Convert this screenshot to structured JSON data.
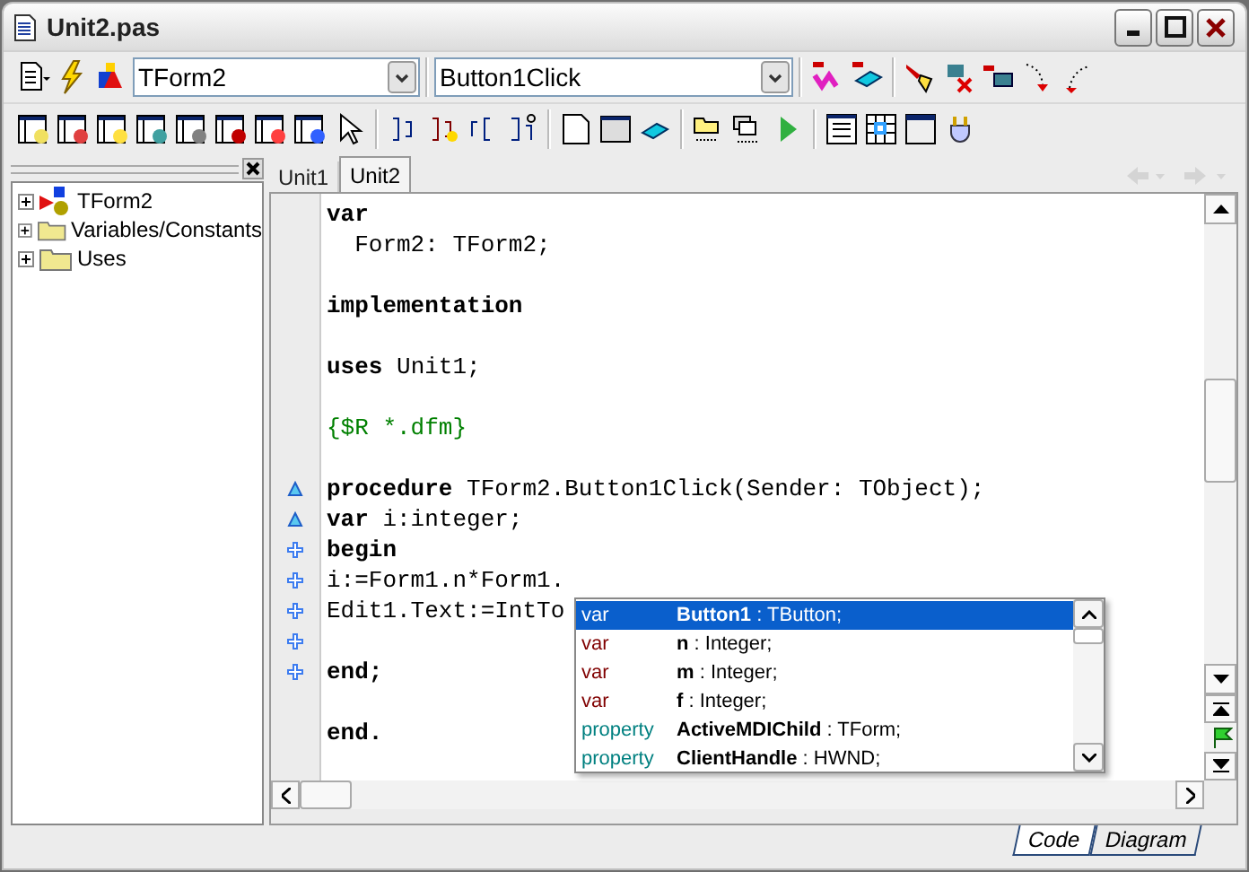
{
  "window": {
    "title": "Unit2.pas"
  },
  "toolbar": {
    "class_combo": {
      "value": "TForm2"
    },
    "method_combo": {
      "value": "Button1Click"
    }
  },
  "tree": [
    {
      "label": "TForm2",
      "kind": "class",
      "expanded": false
    },
    {
      "label": "Variables/Constants",
      "kind": "folder",
      "expanded": false
    },
    {
      "label": "Uses",
      "kind": "folder",
      "expanded": false
    }
  ],
  "editor_tabs": [
    {
      "label": "Unit1",
      "selected": false
    },
    {
      "label": "Unit2",
      "selected": true
    }
  ],
  "code_lines": [
    {
      "kind": "code",
      "text": "**var**"
    },
    {
      "kind": "code",
      "text": "  Form2: TForm2;"
    },
    {
      "kind": "blank"
    },
    {
      "kind": "code",
      "text": "**implementation**"
    },
    {
      "kind": "blank"
    },
    {
      "kind": "code",
      "text": "**uses** Unit1;"
    },
    {
      "kind": "blank"
    },
    {
      "kind": "comment",
      "text": "{$R *.dfm}"
    },
    {
      "kind": "blank"
    },
    {
      "kind": "code",
      "text": "**procedure** TForm2.Button1Click(Sender: TObject);",
      "marker": {
        "kind": "triangle"
      }
    },
    {
      "kind": "code",
      "text": "**var** i:integer;",
      "marker": {
        "kind": "triangle"
      }
    },
    {
      "kind": "code",
      "text": "**begin**",
      "marker": {
        "kind": "plus"
      }
    },
    {
      "kind": "code",
      "text": "i:=Form1.n*Form1.",
      "marker": {
        "kind": "plus"
      }
    },
    {
      "kind": "code",
      "text": "Edit1.Text:=IntTo",
      "marker": {
        "kind": "plus"
      }
    },
    {
      "kind": "blank",
      "marker": {
        "kind": "plus"
      }
    },
    {
      "kind": "code",
      "text": "**end;**",
      "marker": {
        "kind": "plus"
      }
    },
    {
      "kind": "blank"
    },
    {
      "kind": "code",
      "text": "**end.**"
    }
  ],
  "completion": [
    {
      "kind": "var",
      "scope": "var",
      "name": "Button1",
      "type": ": TButton;",
      "selected": true
    },
    {
      "kind": "var",
      "scope": "var",
      "name": "n",
      "type": ": Integer;",
      "selected": false
    },
    {
      "kind": "var",
      "scope": "var",
      "name": "m",
      "type": ": Integer;",
      "selected": false
    },
    {
      "kind": "var",
      "scope": "var",
      "name": "f",
      "type": ": Integer;",
      "selected": false
    },
    {
      "kind": "property",
      "scope": "property",
      "name": "ActiveMDIChild",
      "type": ": TForm;",
      "selected": false
    },
    {
      "kind": "property",
      "scope": "property",
      "name": "ClientHandle",
      "type": ": HWND;",
      "selected": false
    }
  ],
  "view_tabs": [
    {
      "label": "Code",
      "selected": true
    },
    {
      "label": "Diagram",
      "selected": false
    }
  ]
}
